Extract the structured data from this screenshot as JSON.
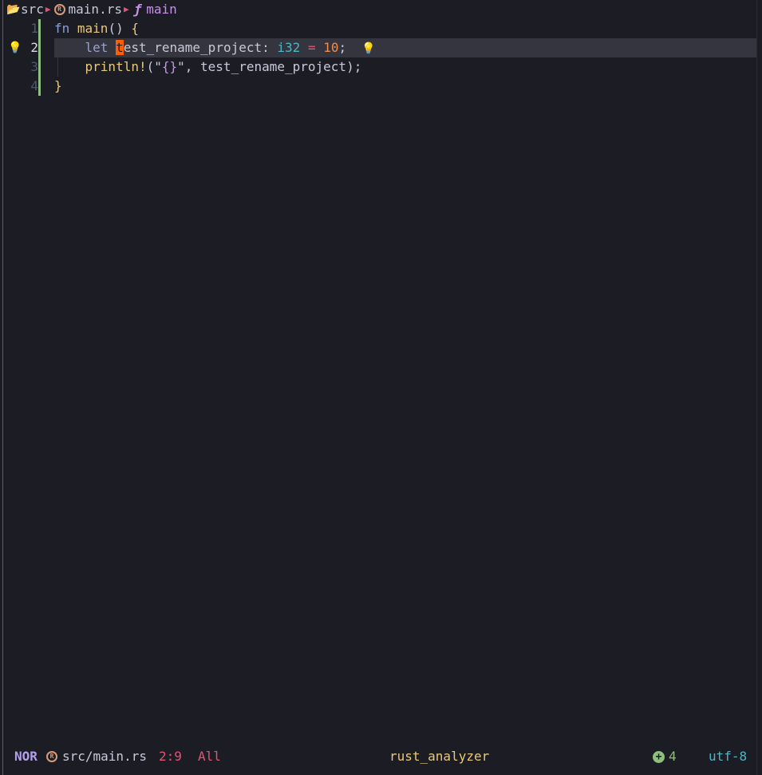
{
  "winbar": {
    "folder": "src",
    "file": "main.rs",
    "symbol": "main"
  },
  "editor": {
    "lines": [
      {
        "number": "1"
      },
      {
        "number": "2"
      },
      {
        "number": "3"
      },
      {
        "number": "4"
      }
    ],
    "code": {
      "l1_kw": "fn",
      "l1_name": "main",
      "l1_parens": "()",
      "l1_brace": "{",
      "l2_kw": "let",
      "l2_cursor_char": "t",
      "l2_ident_rest": "est_rename_project",
      "l2_colon": ":",
      "l2_type": "i32",
      "l2_eq": "=",
      "l2_num": "10",
      "l2_semi": ";",
      "l3_macro": "println!",
      "l3_open": "(\"",
      "l3_fmt": "{}",
      "l3_close_str": "\",",
      "l3_arg": "test_rename_project",
      "l3_end": ");",
      "l4_brace": "}"
    },
    "sign_icon": "lightbulb-icon",
    "virtual_text_icon": "lightbulb-icon"
  },
  "statusline": {
    "mode": "NOR",
    "file": "src/main.rs",
    "position": "2:9",
    "scroll": "All",
    "lsp": "rust_analyzer",
    "diagnostics_count": "4",
    "encoding": "utf-8"
  },
  "colors": {
    "background": "#1c1c24",
    "cursorline": "#35353f",
    "cursor": "#ff5f00",
    "keyword": "#8a9fd4",
    "function": "#e8c979",
    "type": "#4fb5c4",
    "number": "#ef8d4c",
    "operator": "#e05573",
    "git_added": "#8fbf7f",
    "mode": "#b4a0e8"
  }
}
